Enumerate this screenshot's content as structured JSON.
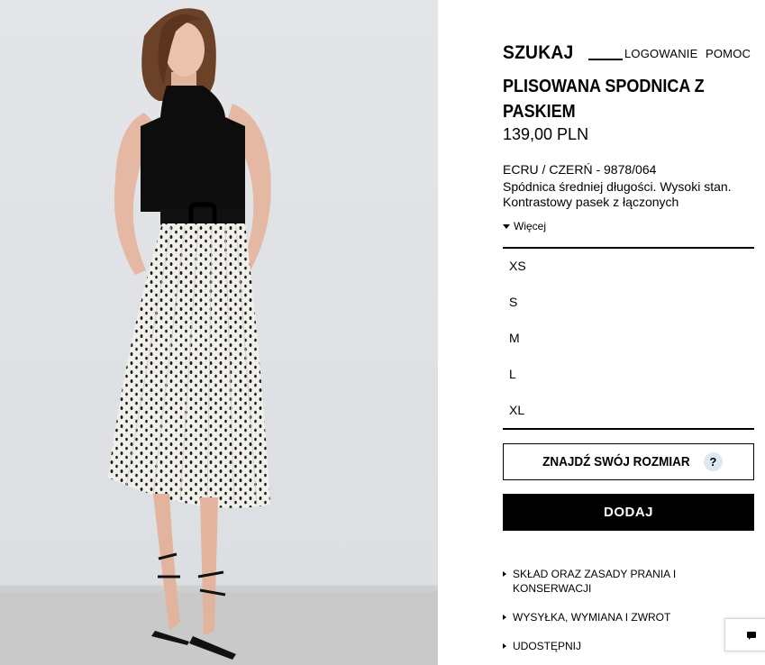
{
  "header": {
    "search_label": "SZUKAJ",
    "login_label": "LOGOWANIE",
    "help_label": "POMOC"
  },
  "product": {
    "title": "PLISOWANA SPÓDNICA Z PASKIEM",
    "price": "139,00 PLN",
    "color_ref": "ECRU / CZERŃ - 9878/064",
    "description": "Spódnica średniej długości. Wysoki stan. Kontrastowy pasek z łączonych",
    "more_label": "Więcej"
  },
  "sizes": [
    "XS",
    "S",
    "M",
    "L",
    "XL"
  ],
  "actions": {
    "find_size_label": "ZNAJDŹ SWÓJ ROZMIAR",
    "help_glyph": "?",
    "add_label": "DODAJ"
  },
  "info_links": [
    "SKŁAD ORAZ ZASADY PRANIA I KONSERWACJI",
    "WYSYŁKA, WYMIANA I ZWROT",
    "UDOSTĘPNIJ"
  ],
  "icons": {
    "chat": "chat-bubble-icon",
    "more": "caret-down-icon",
    "link": "triangle-right-icon",
    "help": "question-icon"
  },
  "colors": {
    "primary": "#000000",
    "background": "#ffffff",
    "help_circle": "#dce9f5",
    "photo_wall": "#e0e2e5"
  }
}
